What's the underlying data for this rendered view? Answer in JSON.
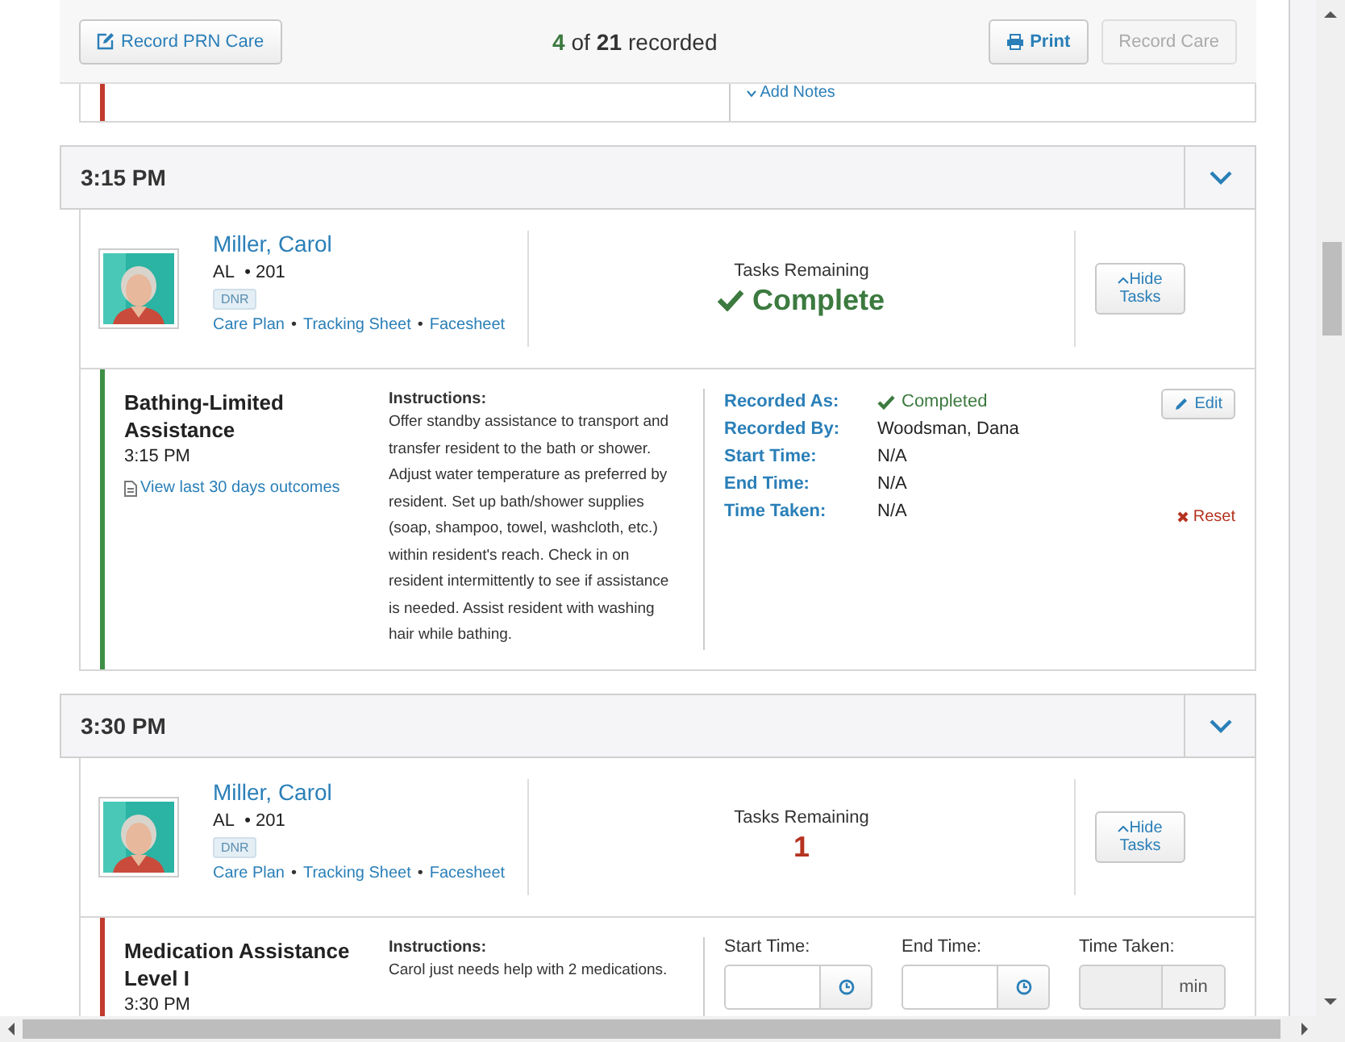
{
  "toolbar": {
    "prn_button": "Record PRN Care",
    "recorded_count": "4",
    "recorded_of": "of",
    "recorded_total": "21",
    "recorded_suffix": "recorded",
    "print_button": "Print",
    "record_button": {
      "label": "Record Care",
      "disabled": true
    }
  },
  "previous_task": {
    "complete": false,
    "add_notes": "Add Notes"
  },
  "sections": [
    {
      "time": "3:15 PM",
      "resident": {
        "name": "Miller, Carol",
        "unit": "AL",
        "room": "• 201",
        "badge": "DNR",
        "links": [
          {
            "label": "Care Plan"
          },
          {
            "separator": "•",
            "label": "Tracking Sheet"
          },
          {
            "separator": "•",
            "label": "Facesheet"
          }
        ],
        "tasks_label": "Tasks Remaining",
        "remaining": "Complete",
        "complete": true,
        "hide_button": "Hide Tasks"
      },
      "task": {
        "complete": true,
        "title": "Bathing-Limited Assistance",
        "time": "3:15 PM",
        "history_link": "View last 30 days outcomes",
        "instructions_label": "Instructions:",
        "instructions": "Offer standby assistance to transport and transfer resident to the bath or shower. Adjust water temperature as preferred by resident. Set up bath/shower supplies (soap, shampoo, towel, washcloth, etc.) within resident's reach. Check in on resident intermittently to see if assistance is needed. Assist resident with washing hair while bathing.",
        "kind": "recorded",
        "fields": [
          {
            "label": "Recorded As:",
            "value": "Completed",
            "checked": true
          },
          {
            "label": "Recorded By:",
            "value": "Woodsman, Dana",
            "checked": false
          },
          {
            "label": "Start Time:",
            "value": "N/A",
            "checked": false
          },
          {
            "label": "End Time:",
            "value": "N/A",
            "checked": false
          },
          {
            "label": "Time Taken:",
            "value": "N/A",
            "checked": false
          }
        ],
        "edit_button": "Edit",
        "reset_button": "Reset"
      }
    },
    {
      "time": "3:30 PM",
      "resident": {
        "name": "Miller, Carol",
        "unit": "AL",
        "room": "• 201",
        "badge": "DNR",
        "links": [
          {
            "label": "Care Plan"
          },
          {
            "separator": "•",
            "label": "Tracking Sheet"
          },
          {
            "separator": "•",
            "label": "Facesheet"
          }
        ],
        "tasks_label": "Tasks Remaining",
        "remaining": "1",
        "complete": false,
        "hide_button": "Hide Tasks"
      },
      "task": {
        "complete": false,
        "title": "Medication Assistance Level I",
        "time": "3:30 PM",
        "instructions_label": "Instructions:",
        "instructions": "Carol just needs help with 2 medications.",
        "kind": "form",
        "inputs": [
          {
            "label": "Start Time:",
            "kind": "time",
            "disabled": false
          },
          {
            "label": "End Time:",
            "kind": "time",
            "disabled": false
          },
          {
            "label": "Time Taken:",
            "kind": "duration",
            "unit": "min",
            "disabled": true
          }
        ]
      }
    }
  ]
}
